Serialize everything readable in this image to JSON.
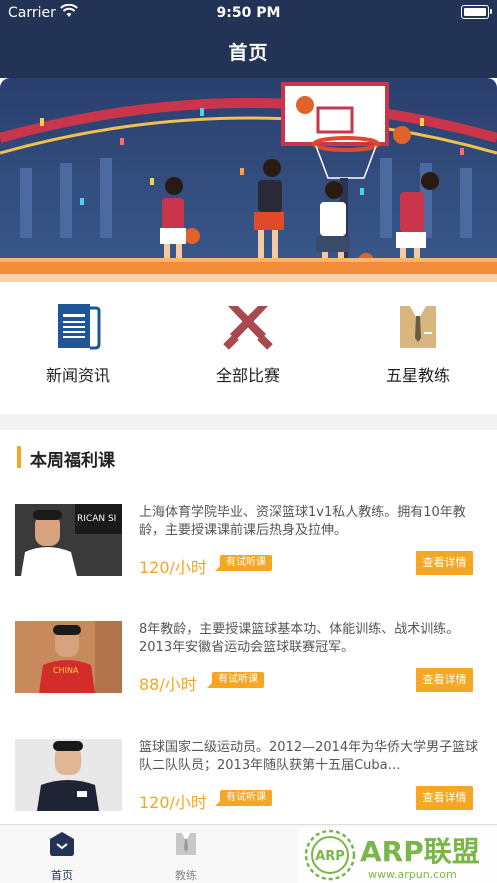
{
  "status_bar": {
    "carrier": "Carrier",
    "time": "9:50 PM"
  },
  "header": {
    "title": "首页"
  },
  "nav": {
    "items": [
      {
        "label": "新闻资讯",
        "icon": "newspaper-icon"
      },
      {
        "label": "全部比赛",
        "icon": "crossed-swords-icon"
      },
      {
        "label": "五星教练",
        "icon": "coach-suit-icon"
      }
    ]
  },
  "section": {
    "title": "本周福利课"
  },
  "courses": [
    {
      "desc": "上海体育学院毕业、资深篮球1v1私人教练。拥有10年教龄，主要授课课前课后热身及拉伸。",
      "price": "120/小时",
      "badge": "有试听课",
      "button": "查看详情",
      "photo_text": "RICAN SI"
    },
    {
      "desc": "8年教龄，主要授课篮球基本功、体能训练、战术训练。2013年安徽省运动会篮球联赛冠军。",
      "price": "88/小时",
      "badge": "有试听课",
      "button": "查看详情",
      "photo_text": "CHINA"
    },
    {
      "desc": "篮球国家二级运动员。2012—2014年为华侨大学男子篮球队二队队员；2013年随队获第十五届Cuba…",
      "price": "120/小时",
      "badge": "有试听课",
      "button": "查看详情",
      "photo_text": ""
    }
  ],
  "tabbar": {
    "tabs": [
      {
        "label": "首页",
        "icon": "home-icon",
        "active": true
      },
      {
        "label": "教练",
        "icon": "coach-icon",
        "active": false
      }
    ]
  },
  "watermark": {
    "brand": "ARP联盟",
    "url": "www.arpun.com",
    "badge": "ARP"
  },
  "colors": {
    "header": "#233355",
    "accent": "#f5a623"
  }
}
